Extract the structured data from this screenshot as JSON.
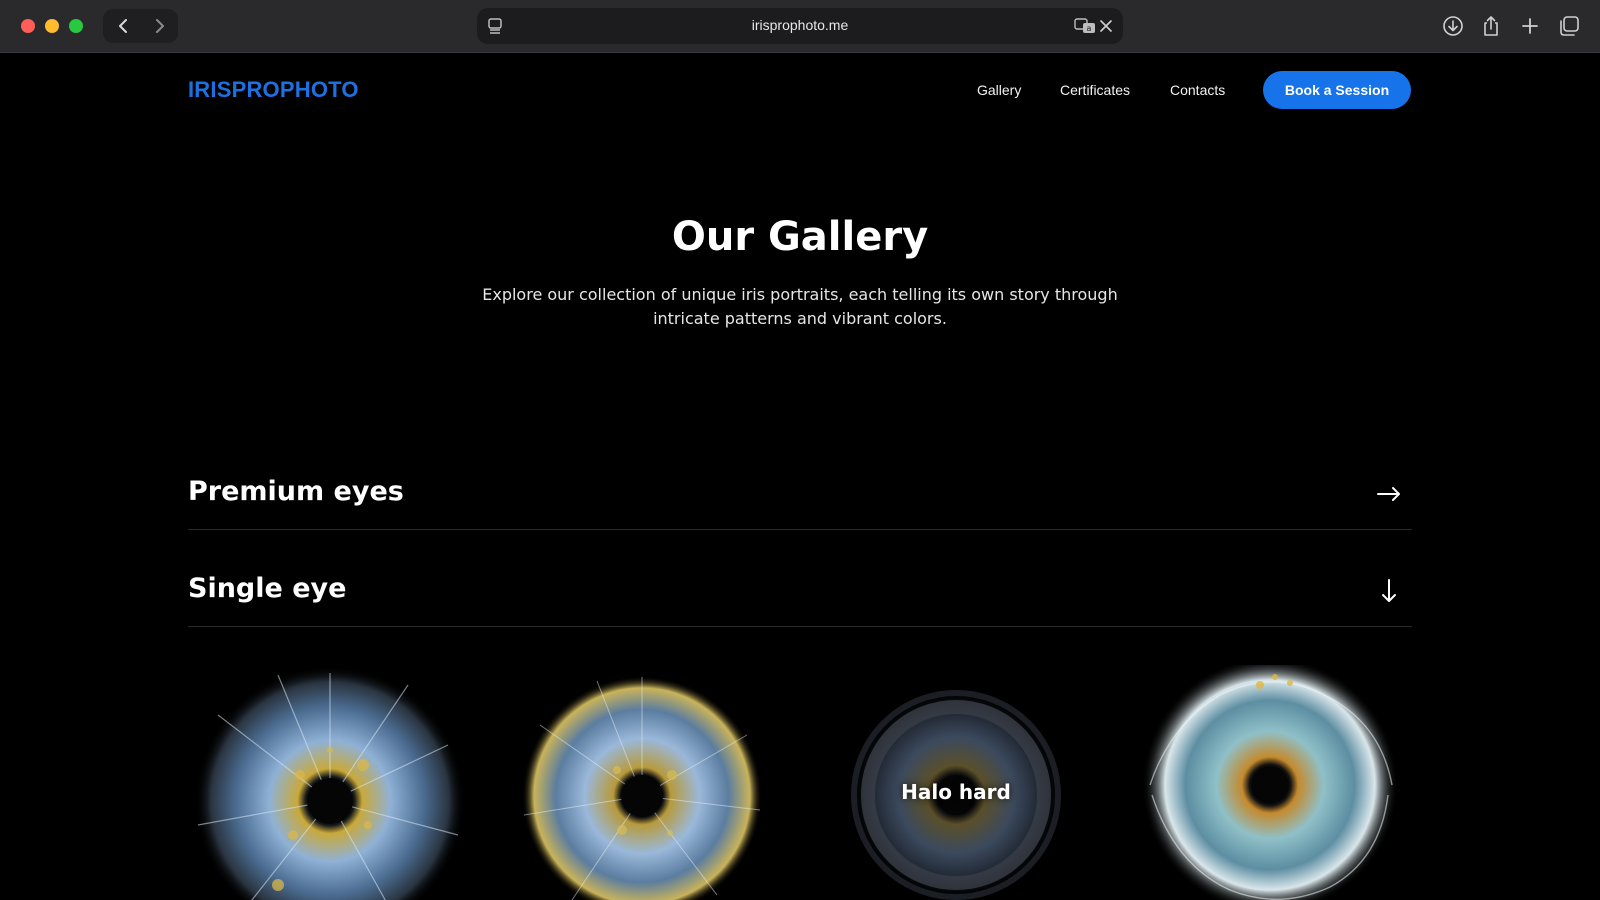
{
  "browser": {
    "url": "irisprophoto.me",
    "icons": [
      "back-icon",
      "forward-icon",
      "reader-icon",
      "translate-icon",
      "close-icon",
      "download-icon",
      "share-icon",
      "new-tab-icon",
      "tabs-overview-icon"
    ]
  },
  "header": {
    "logo": "IRISPROPHOTO",
    "nav": {
      "gallery": "Gallery",
      "certificates": "Certificates",
      "contacts": "Contacts"
    },
    "cta": "Book a Session"
  },
  "hero": {
    "title": "Our Gallery",
    "subtitle": "Explore our collection of unique iris portraits, each telling its own story through intricate patterns and vibrant colors."
  },
  "accordion": [
    {
      "title": "Premium eyes",
      "state": "collapsed",
      "icon": "arrow-right-icon"
    },
    {
      "title": "Single eye",
      "state": "expanded",
      "icon": "arrow-down-icon"
    }
  ],
  "gallery": {
    "items": [
      {
        "style": "explosion",
        "label": ""
      },
      {
        "style": "radial",
        "label": ""
      },
      {
        "style": "halo",
        "label": "Halo hard"
      },
      {
        "style": "splash",
        "label": ""
      }
    ]
  },
  "colors": {
    "accent": "#1673ea",
    "logo": "#1e6fe0",
    "background": "#000000"
  }
}
